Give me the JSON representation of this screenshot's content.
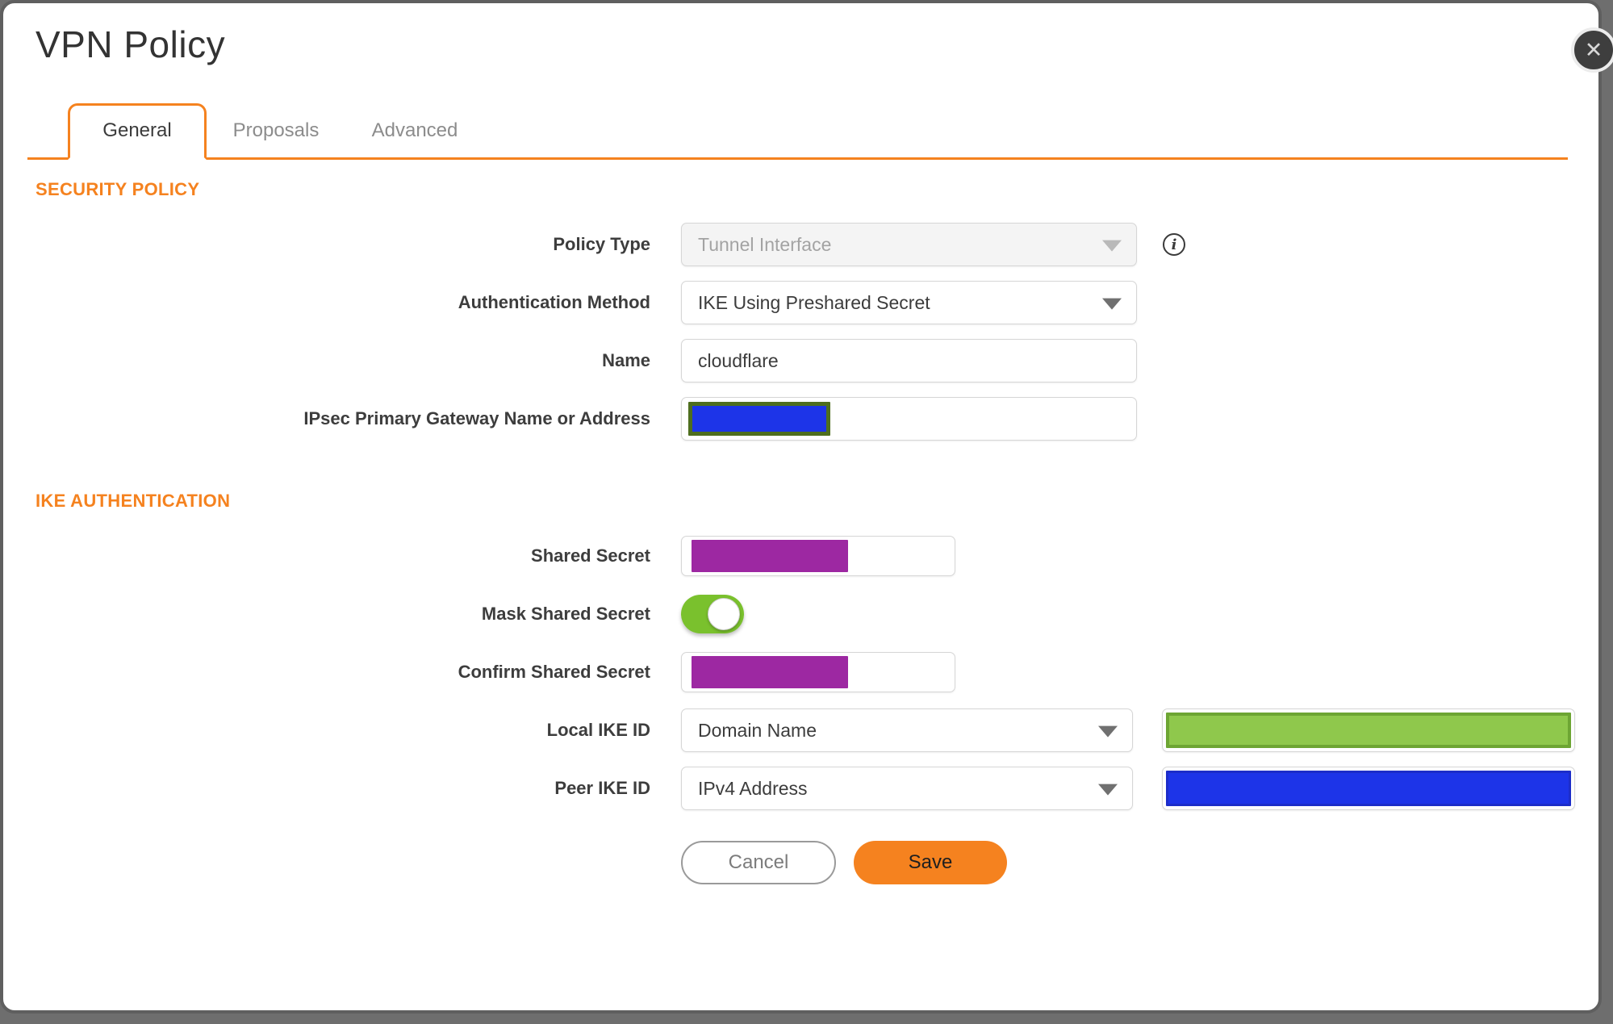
{
  "colors": {
    "accent-orange": "#f5821f",
    "text-dark": "#3b3b3b",
    "text-muted": "#8c8c8c",
    "field-border": "#d6d6d6",
    "backdrop": "#6e6e6e",
    "redact-blue": "#1d34e8",
    "redact-blue-border": "#1c2dc9",
    "redact-purple": "#9d28a2",
    "redact-green": "#8fc84c",
    "redact-green-border": "#6da533",
    "redact-olive-border": "#4e6e1e",
    "toggle-green": "#7ac12d"
  },
  "dialog": {
    "title": "VPN Policy",
    "close_glyph": "✕"
  },
  "tabs": {
    "general": "General",
    "proposals": "Proposals",
    "advanced": "Advanced",
    "active_tab": "General"
  },
  "security_policy": {
    "heading": "SECURITY POLICY",
    "policy_type_label": "Policy Type",
    "policy_type_value": "Tunnel Interface",
    "policy_type_disabled": "true",
    "info_glyph": "i",
    "auth_method_label": "Authentication Method",
    "auth_method_value": "IKE Using Preshared Secret",
    "name_label": "Name",
    "name_value": "cloudflare",
    "gateway_label": "IPsec Primary Gateway Name or Address",
    "gateway_value_state": "masked-blue-redaction"
  },
  "ike_authentication": {
    "heading": "IKE AUTHENTICATION",
    "shared_secret_label": "Shared Secret",
    "shared_secret_state": "masked-purple-redaction",
    "mask_shared_secret_label": "Mask Shared Secret",
    "mask_shared_secret_state": "on",
    "confirm_shared_secret_label": "Confirm Shared Secret",
    "confirm_shared_secret_state": "masked-purple-redaction",
    "local_ike_id_label": "Local IKE ID",
    "local_ike_id_type": "Domain Name",
    "local_ike_id_value_state": "masked-green-redaction",
    "peer_ike_id_label": "Peer IKE ID",
    "peer_ike_id_type": "IPv4 Address",
    "peer_ike_id_value_state": "masked-blue-redaction"
  },
  "footer": {
    "cancel": "Cancel",
    "save": "Save"
  }
}
